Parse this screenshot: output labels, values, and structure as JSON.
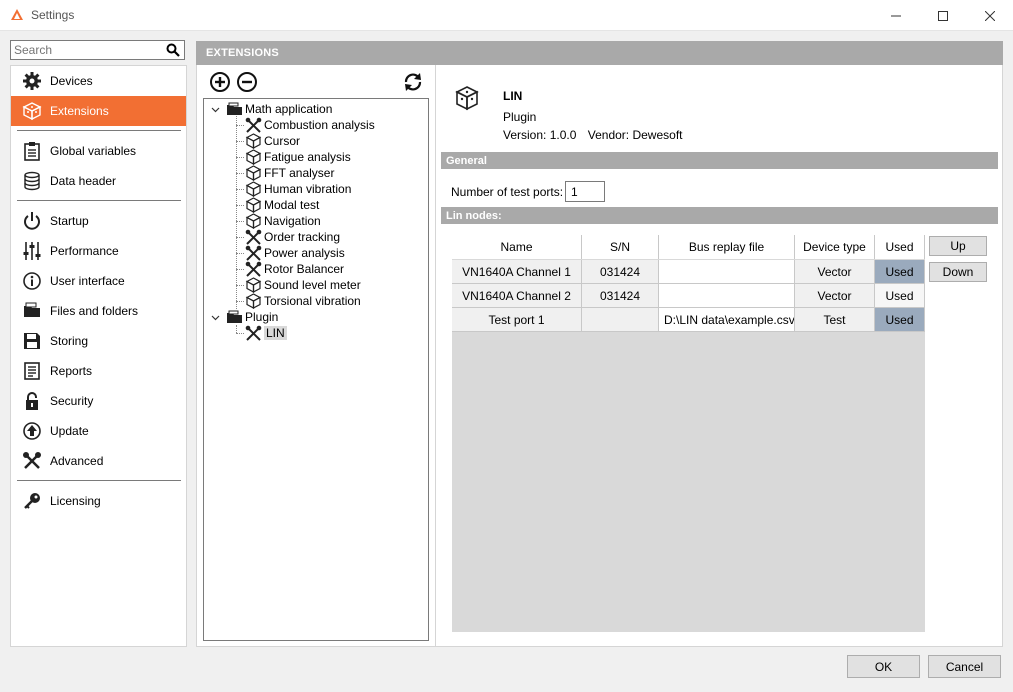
{
  "window": {
    "title": "Settings"
  },
  "search": {
    "placeholder": "Search"
  },
  "sidebar": {
    "items": [
      {
        "label": "Devices",
        "icon": "gear-icon",
        "active": false
      },
      {
        "label": "Extensions",
        "icon": "cube-icon",
        "active": true
      },
      {
        "label": "Global variables",
        "icon": "clipboard-icon",
        "active": false
      },
      {
        "label": "Data header",
        "icon": "database-icon",
        "active": false
      },
      {
        "label": "Startup",
        "icon": "power-icon",
        "active": false
      },
      {
        "label": "Performance",
        "icon": "sliders-icon",
        "active": false
      },
      {
        "label": "User interface",
        "icon": "info-icon",
        "active": false
      },
      {
        "label": "Files and folders",
        "icon": "folder-icon",
        "active": false
      },
      {
        "label": "Storing",
        "icon": "floppy-icon",
        "active": false
      },
      {
        "label": "Reports",
        "icon": "report-icon",
        "active": false
      },
      {
        "label": "Security",
        "icon": "lock-icon",
        "active": false
      },
      {
        "label": "Update",
        "icon": "update-icon",
        "active": false
      },
      {
        "label": "Advanced",
        "icon": "tools-icon",
        "active": false
      },
      {
        "label": "Licensing",
        "icon": "key-icon",
        "active": false
      }
    ]
  },
  "extensions": {
    "header": "EXTENSIONS",
    "tree": {
      "groups": [
        {
          "label": "Math application",
          "children": [
            {
              "label": "Combustion analysis",
              "icon": "tools-icon"
            },
            {
              "label": "Cursor",
              "icon": "cube-icon"
            },
            {
              "label": "Fatigue analysis",
              "icon": "cube-icon"
            },
            {
              "label": "FFT analyser",
              "icon": "cube-icon"
            },
            {
              "label": "Human vibration",
              "icon": "cube-icon"
            },
            {
              "label": "Modal test",
              "icon": "cube-icon"
            },
            {
              "label": "Navigation",
              "icon": "cube-icon"
            },
            {
              "label": "Order tracking",
              "icon": "tools-icon"
            },
            {
              "label": "Power analysis",
              "icon": "tools-icon"
            },
            {
              "label": "Rotor Balancer",
              "icon": "tools-icon"
            },
            {
              "label": "Sound level meter",
              "icon": "cube-icon"
            },
            {
              "label": "Torsional vibration",
              "icon": "cube-icon"
            }
          ]
        },
        {
          "label": "Plugin",
          "children": [
            {
              "label": "LIN",
              "icon": "tools-icon",
              "selected": true
            }
          ]
        }
      ]
    },
    "detail": {
      "name": "LIN",
      "type": "Plugin",
      "version_label": "Version:",
      "version": "1.0.0",
      "vendor_label": "Vendor:",
      "vendor": "Dewesoft"
    },
    "general": {
      "title": "General",
      "ports_label": "Number of test ports:",
      "ports_value": "1"
    },
    "lin_nodes": {
      "title": "Lin nodes:",
      "columns": [
        "Name",
        "S/N",
        "Bus replay file",
        "Device type",
        "Used"
      ],
      "rows": [
        {
          "name": "VN1640A Channel 1",
          "sn": "031424",
          "file": "",
          "device_type": "Vector",
          "used": "Used",
          "used_on": true
        },
        {
          "name": "VN1640A Channel 2",
          "sn": "031424",
          "file": "",
          "device_type": "Vector",
          "used": "Used",
          "used_on": false
        },
        {
          "name": "Test port 1",
          "sn": "",
          "file": "D:\\LIN data\\example.csv",
          "device_type": "Test",
          "used": "Used",
          "used_on": true
        }
      ],
      "up_label": "Up",
      "down_label": "Down"
    }
  },
  "footer": {
    "ok_label": "OK",
    "cancel_label": "Cancel"
  },
  "colors": {
    "accent": "#f26f33",
    "section_bar": "#a9a9a9",
    "used_on": "#9aaabd"
  }
}
